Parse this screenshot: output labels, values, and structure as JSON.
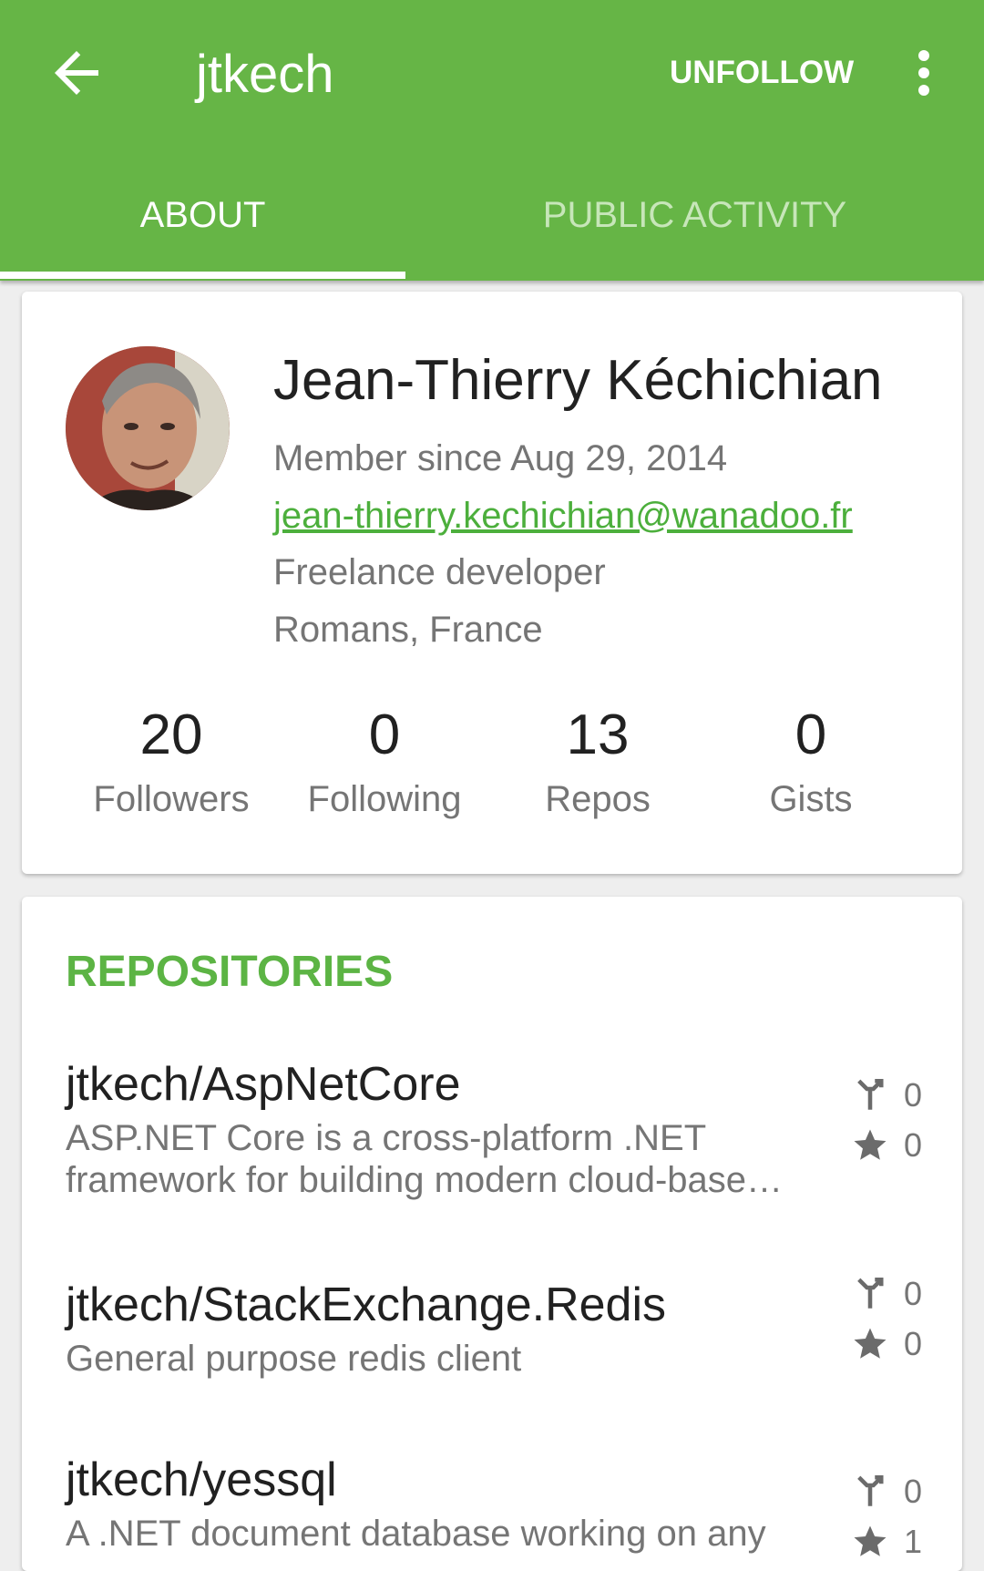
{
  "appbar": {
    "title": "jtkech",
    "unfollow_label": "UNFOLLOW",
    "color": "#66b546"
  },
  "tabs": [
    {
      "label": "ABOUT",
      "selected": true
    },
    {
      "label": "PUBLIC ACTIVITY",
      "selected": false
    }
  ],
  "profile": {
    "name": "Jean-Thierry Kéchichian",
    "member_since": "Member since Aug 29, 2014",
    "email": "jean-thierry.kechichian@wanadoo.fr",
    "bio": "Freelance developer",
    "location": "Romans, France",
    "stats": [
      {
        "value": "20",
        "label": "Followers"
      },
      {
        "value": "0",
        "label": "Following"
      },
      {
        "value": "13",
        "label": "Repos"
      },
      {
        "value": "0",
        "label": "Gists"
      }
    ]
  },
  "repositories": {
    "header": "REPOSITORIES",
    "items": [
      {
        "name": "jtkech/AspNetCore",
        "description": "ASP.NET Core is a cross-platform .NET framework for building modern cloud-base…",
        "forks": "0",
        "stars": "0"
      },
      {
        "name": "jtkech/StackExchange.Redis",
        "description": "General purpose redis client",
        "forks": "0",
        "stars": "0"
      },
      {
        "name": "jtkech/yessql",
        "description": "A .NET document database working on any",
        "forks": "0",
        "stars": "1"
      }
    ]
  },
  "icons": {
    "back": "arrow-back-icon",
    "overflow": "more-vert-icon",
    "fork": "fork-icon",
    "star": "star-icon"
  }
}
